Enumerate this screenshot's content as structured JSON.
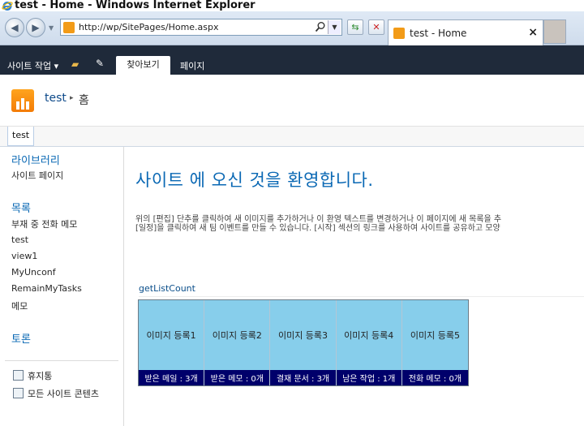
{
  "window": {
    "title": "test - Home - Windows Internet Explorer"
  },
  "browser": {
    "address": "http://wp/SitePages/Home.aspx",
    "tab_title": "test - Home",
    "close_glyph": "×"
  },
  "ribbon": {
    "site_actions": "사이트 작업 ▾",
    "tabs": [
      "찾아보기",
      "페이지"
    ]
  },
  "breadcrumb": {
    "site": "test",
    "separator": "▸",
    "page": "홈"
  },
  "topnav": {
    "items": [
      "test"
    ]
  },
  "quicklaunch": {
    "sections": [
      {
        "heading": "라이브러리",
        "items": [
          "사이트 페이지"
        ]
      },
      {
        "heading": "목록",
        "items": [
          "부재 중 전화 메모",
          "test",
          "view1",
          "MyUnconf",
          "RemainMyTasks",
          "메모"
        ]
      },
      {
        "heading": "토론",
        "items": []
      }
    ],
    "footer": [
      {
        "label": "휴지통",
        "icon": "recycle-bin-icon"
      },
      {
        "label": "모든 사이트 콘텐츠",
        "icon": "site-content-icon"
      }
    ]
  },
  "main": {
    "welcome": "사이트 에 오신 것을 환영합니다.",
    "desc_line1": "위의 [편집] 단추를 클릭하여 새 이미지를 추가하거나 이 환영 텍스트를 변경하거나 이 페이지에 새 목록을 추",
    "desc_line2": "[일정]을 클릭하여 새 팀 이벤트를 만들 수 있습니다. [시작] 섹션의 링크를 사용하여 사이트를 공유하고 모양",
    "webpart_title": "getListCount",
    "tiles": [
      {
        "label": "이미지 등록1",
        "count": "받은 메일 : 3개"
      },
      {
        "label": "이미지 등록2",
        "count": "받은 메모 : 0개"
      },
      {
        "label": "이미지 등록3",
        "count": "결재 문서 : 3개"
      },
      {
        "label": "이미지 등록4",
        "count": "남은 작업 : 1개"
      },
      {
        "label": "이미지 등록5",
        "count": "전화 메모 : 0개"
      }
    ]
  },
  "colors": {
    "ribbon_bg": "#1f2a3a",
    "accent_blue": "#0a68b4",
    "tile_bg": "#87ceeb",
    "tile_count_bg": "#00006b",
    "logo_orange": "#f37b05"
  }
}
